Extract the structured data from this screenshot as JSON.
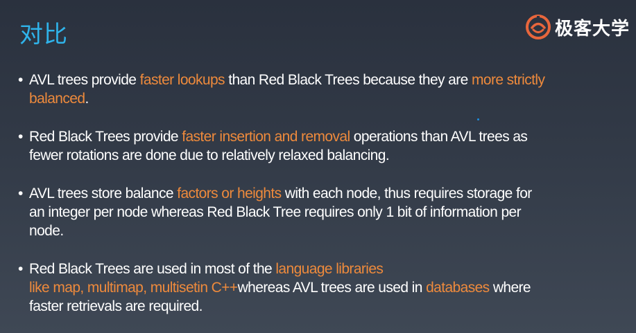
{
  "slide": {
    "title": "对比"
  },
  "logo": {
    "text": "极客大学",
    "icon": "geek-university-logo-icon",
    "accent_color": "#e8663c"
  },
  "colors": {
    "title": "#2fb3ea",
    "highlight": "#ee8a3c",
    "body_text": "#ffffff"
  },
  "bullets": [
    {
      "segments": [
        {
          "text": "AVL trees provide ",
          "highlight": false
        },
        {
          "text": "faster lookups",
          "highlight": true
        },
        {
          "text": " than Red Black Trees because they are ",
          "highlight": false
        },
        {
          "text": "more strictly",
          "highlight": true
        },
        {
          "text": "\nbalanced",
          "highlight": true
        },
        {
          "text": ".",
          "highlight": false
        }
      ]
    },
    {
      "segments": [
        {
          "text": "Red Black Trees provide ",
          "highlight": false
        },
        {
          "text": "faster insertion and removal",
          "highlight": true
        },
        {
          "text": " operations than AVL trees as\nfewer rotations are done due to relatively relaxed balancing.",
          "highlight": false
        }
      ]
    },
    {
      "segments": [
        {
          "text": "AVL trees store balance ",
          "highlight": false
        },
        {
          "text": "factors or heights",
          "highlight": true
        },
        {
          "text": " with each node, thus requires storage for\nan integer per node whereas Red Black Tree requires only 1 bit of information per\nnode.",
          "highlight": false
        }
      ]
    },
    {
      "segments": [
        {
          "text": "Red Black Trees are used in most of the ",
          "highlight": false
        },
        {
          "text": "language libraries\nlike map, multimap, multisetin C++",
          "highlight": true
        },
        {
          "text": "whereas AVL trees are used in ",
          "highlight": false
        },
        {
          "text": "databases",
          "highlight": true
        },
        {
          "text": " where\nfaster retrievals are required.",
          "highlight": false
        }
      ]
    }
  ]
}
